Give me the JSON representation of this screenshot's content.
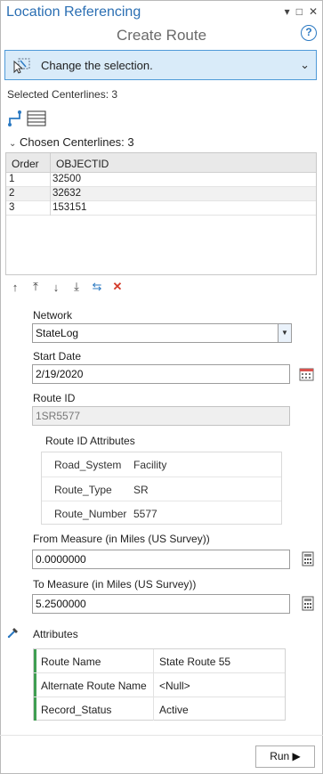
{
  "pane": {
    "title": "Location Referencing",
    "controls": {
      "menu": "▾",
      "maximize": "□",
      "close": "✕"
    },
    "subtitle": "Create Route",
    "help": "?"
  },
  "selection": {
    "instruction": "Change the selection.",
    "chevron": "⌄",
    "count_label": "Selected Centerlines: 3"
  },
  "chosen": {
    "header": "Chosen Centerlines: 3",
    "columns": [
      "Order",
      "OBJECTID"
    ],
    "rows": [
      {
        "order": "1",
        "objectid": "32500"
      },
      {
        "order": "2",
        "objectid": "32632"
      },
      {
        "order": "3",
        "objectid": "153151"
      }
    ]
  },
  "row_tools": {
    "move_up": "↑",
    "move_top": "⤒",
    "move_down": "↓",
    "move_bottom": "⤓",
    "reverse": "⇆",
    "remove": "✕"
  },
  "form": {
    "network_label": "Network",
    "network_value": "StateLog",
    "start_date_label": "Start Date",
    "start_date_value": "2/19/2020",
    "route_id_label": "Route ID",
    "route_id_value": "1SR5577",
    "route_id_attrs_label": "Route ID Attributes",
    "route_id_attrs": [
      {
        "key": "Road_System",
        "value": "Facility"
      },
      {
        "key": "Route_Type",
        "value": "SR"
      },
      {
        "key": "Route_Number",
        "value": "5577"
      }
    ],
    "from_measure_label": "From Measure (in Miles (US Survey))",
    "from_measure_value": "0.0000000",
    "to_measure_label": "To Measure (in Miles (US Survey))",
    "to_measure_value": "5.2500000"
  },
  "attributes": {
    "label": "Attributes",
    "rows": [
      {
        "key": "Route Name",
        "value": "State Route 55"
      },
      {
        "key": "Alternate Route Name",
        "value": "<Null>"
      },
      {
        "key": "Record_Status",
        "value": "Active"
      }
    ]
  },
  "footer": {
    "run_label": "Run ▶"
  },
  "colors": {
    "accent": "#2b6fb3",
    "selection_bg": "#d9ebf9",
    "required_marker": "#3f9e52",
    "remove": "#d43b2a"
  }
}
